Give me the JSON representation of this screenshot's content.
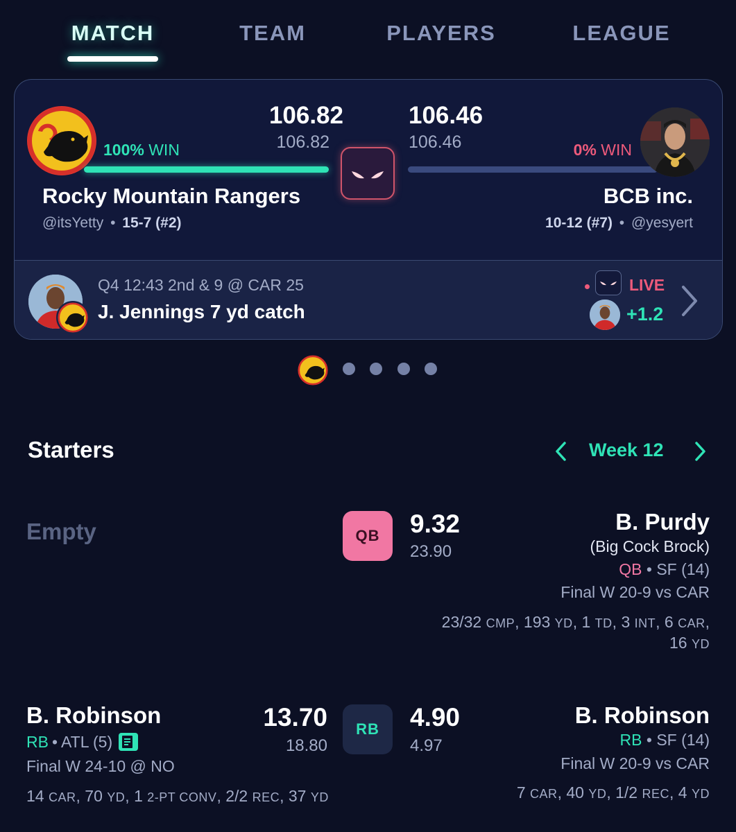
{
  "tabs": [
    {
      "label": "MATCH",
      "active": true
    },
    {
      "label": "TEAM",
      "active": false
    },
    {
      "label": "PLAYERS",
      "active": false
    },
    {
      "label": "LEAGUE",
      "active": false
    }
  ],
  "matchup": {
    "home": {
      "name": "Rocky Mountain Rangers",
      "handle": "@itsYetty",
      "record": "15-7 (#2)",
      "score": "106.82",
      "projected": "106.82",
      "win_pct": "100%",
      "win_word": "WIN",
      "logo_icon": "bear-logo-icon",
      "win_fraction": 1.0
    },
    "away": {
      "name": "BCB inc.",
      "handle": "@yesyert",
      "record": "10-12 (#7)",
      "score": "106.46",
      "projected": "106.46",
      "win_pct": "0%",
      "win_word": "WIN",
      "logo_icon": "avatar-photo-icon",
      "win_fraction": 0.0
    },
    "separator": "•"
  },
  "live_play": {
    "situation": "Q4 12:43 2nd & 9 @ CAR 25",
    "description": "J. Jennings 7 yd catch",
    "status": "LIVE",
    "points": "+1.2"
  },
  "pager": {
    "count": 5,
    "active_index": 0
  },
  "starters": {
    "title": "Starters",
    "week": "Week 12",
    "rows": [
      {
        "position": "QB",
        "pos_color": "#f177a3",
        "left_empty_label": "Empty",
        "right": {
          "name": "B. Purdy",
          "nickname": "(Big Cock Brock)",
          "pos": "QB",
          "team": "SF (14)",
          "game": "Final W 20-9 vs CAR",
          "points": "9.32",
          "projected": "23.90",
          "stats_line1_parts": [
            "23/32",
            "CMP",
            "193",
            "YD",
            "1",
            "TD",
            "3",
            "INT",
            "6",
            "CAR"
          ],
          "stats_line2_parts": [
            "16",
            "YD"
          ]
        }
      },
      {
        "position": "RB",
        "pos_color": "#2fe3b6",
        "left": {
          "name": "B. Robinson",
          "pos": "RB",
          "team": "ATL (5)",
          "game": "Final W 24-10 @ NO",
          "points": "13.70",
          "projected": "18.80",
          "stats_parts": [
            "14",
            "CAR",
            "70",
            "YD",
            "1",
            "2-PT CONV",
            "2/2",
            "REC",
            "37",
            "YD"
          ]
        },
        "right": {
          "name": "B. Robinson",
          "pos": "RB",
          "team": "SF (14)",
          "game": "Final W 20-9 vs CAR",
          "points": "4.90",
          "projected": "4.97",
          "stats_parts": [
            "7",
            "CAR",
            "40",
            "YD",
            "1/2",
            "REC",
            "4",
            "YD"
          ]
        }
      }
    ]
  },
  "colors": {
    "accent": "#2fe3b6",
    "live": "#ee5a7b",
    "background": "#0c1024"
  }
}
